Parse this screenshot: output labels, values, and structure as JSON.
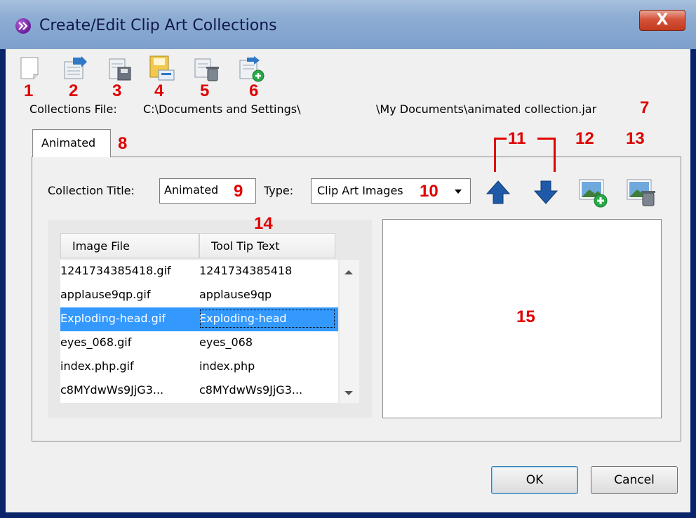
{
  "window": {
    "title": "Create/Edit Clip Art Collections",
    "close_label": "X"
  },
  "toolbar": {
    "items": [
      {
        "name": "new-document-icon",
        "callout": "1"
      },
      {
        "name": "open-collection-icon",
        "callout": "2"
      },
      {
        "name": "save-icon",
        "callout": "3"
      },
      {
        "name": "save-as-icon",
        "callout": "4"
      },
      {
        "name": "delete-collection-icon",
        "callout": "5"
      },
      {
        "name": "add-collection-icon",
        "callout": "6"
      }
    ]
  },
  "collections_file": {
    "label": "Collections File:",
    "path_start": "C:\\Documents and Settings\\",
    "path_end": "\\My Documents\\animated collection.jar",
    "callout": "7"
  },
  "tabs": [
    {
      "label": "Animated",
      "callout": "8",
      "selected": true
    }
  ],
  "collection": {
    "title_label": "Collection Title:",
    "title_value": "Animated",
    "title_callout": "9",
    "type_label": "Type:",
    "type_value": "Clip Art Images",
    "type_callout": "10",
    "move_callout": "11",
    "add_image_callout": "12",
    "delete_image_callout": "13"
  },
  "table": {
    "callout": "14",
    "headers": [
      "Image File",
      "Tool Tip Text"
    ],
    "rows": [
      {
        "file": "1241734385418.gif",
        "tooltip": "1241734385418"
      },
      {
        "file": "applause9qp.gif",
        "tooltip": "applause9qp"
      },
      {
        "file": "Exploding-head.gif",
        "tooltip": "Exploding-head",
        "selected": true
      },
      {
        "file": "eyes_068.gif",
        "tooltip": "eyes_068"
      },
      {
        "file": "index.php.gif",
        "tooltip": "index.php"
      },
      {
        "file": "c8MYdwWs9JjG3...",
        "tooltip": "c8MYdwWs9JjG3..."
      }
    ]
  },
  "preview": {
    "callout": "15"
  },
  "buttons": {
    "ok": "OK",
    "cancel": "Cancel"
  },
  "colors": {
    "callout": "#e00000",
    "selection": "#3399ff",
    "arrow_blue": "#1e5aa8"
  }
}
